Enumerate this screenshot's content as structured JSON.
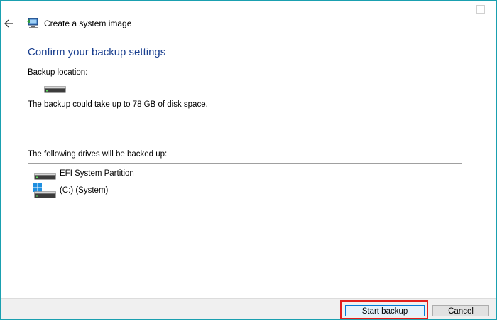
{
  "window": {
    "title": "Create a system image",
    "border_color": "#1aa0b0"
  },
  "icons": {
    "back": "back-arrow-icon",
    "title": "backup-wizard-icon",
    "drive": "hard-drive-icon",
    "windows": "windows-logo-icon"
  },
  "main": {
    "heading": "Confirm your backup settings",
    "heading_color": "#1a3f8f",
    "backup_location_label": "Backup location:",
    "space_text": "The backup could take up to 78 GB of disk space.",
    "drives_label": "The following drives will be backed up:",
    "drives": [
      {
        "name": "EFI System Partition",
        "icon": "hard-drive-icon"
      },
      {
        "name": "(C:) (System)",
        "icon": "windows-drive-icon"
      }
    ]
  },
  "footer": {
    "start_label": "Start backup",
    "cancel_label": "Cancel",
    "highlight_color": "#e21c1c"
  }
}
